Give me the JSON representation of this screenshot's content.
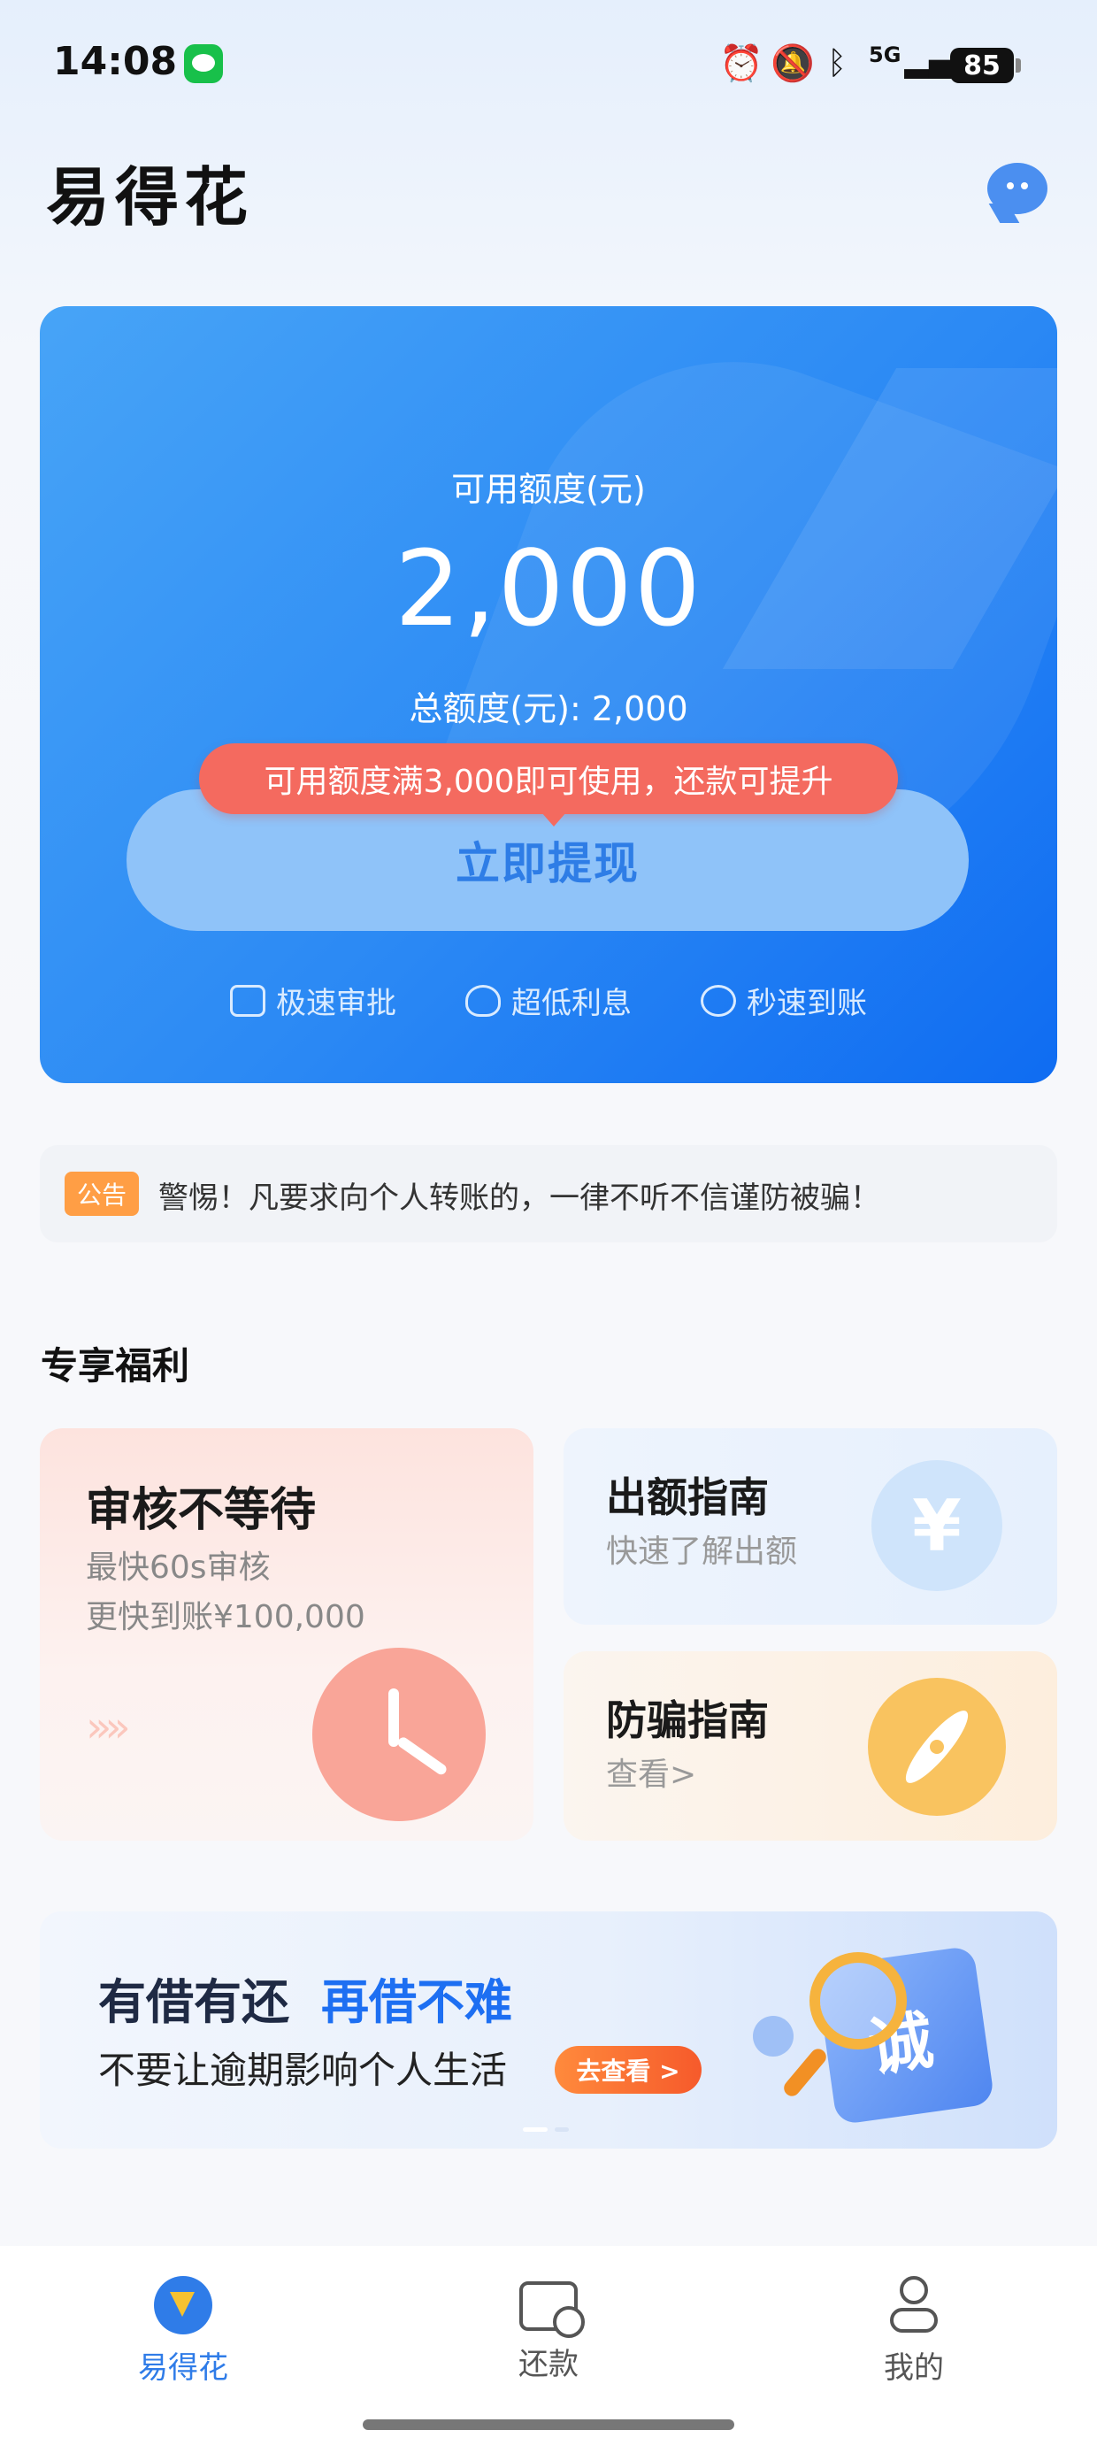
{
  "status_bar": {
    "time": "14:08",
    "network": "5G",
    "battery": "85",
    "icons": [
      "wechat-icon",
      "alarm-icon",
      "mute-icon",
      "bluetooth-icon",
      "signal-icon",
      "battery-icon"
    ]
  },
  "header": {
    "app_title": "易得花",
    "icons": [
      "chat-bubble-icon"
    ]
  },
  "credit_card": {
    "available_label": "可用额度(元)",
    "available_value": "2,000",
    "total_label": "总额度(元): 2,000",
    "tip": "可用额度满3,000即可使用，还款可提升",
    "withdraw_button": "立即提现",
    "features": [
      {
        "label": "极速审批",
        "icon": "fast-approval-icon"
      },
      {
        "label": "超低利息",
        "icon": "low-interest-icon"
      },
      {
        "label": "秒速到账",
        "icon": "instant-arrival-icon"
      }
    ]
  },
  "notice": {
    "badge": "公告",
    "text": "警惕！凡要求向个人转账的，一律不听不信谨防被骗！"
  },
  "benefits": {
    "section_title": "专享福利",
    "big": {
      "title": "审核不等待",
      "sub1": "最快60s审核",
      "sub2": "更快到账¥100,000",
      "arrows": "»»",
      "icon": "clock-icon"
    },
    "guide": {
      "title": "出额指南",
      "sub": "快速了解出额",
      "icon_glyph": "¥"
    },
    "fraud": {
      "title": "防骗指南",
      "sub": "查看>",
      "icon": "compass-icon"
    }
  },
  "banner": {
    "title_part1": "有借有还",
    "title_part2": "再借不难",
    "subtitle": "不要让逾期影响个人生活",
    "button": "去查看 >",
    "illustration_glyph": "诚",
    "page_count": 2,
    "active_page": 1
  },
  "tab_bar": {
    "tabs": [
      {
        "label": "易得花",
        "icon": "home-logo-icon",
        "active": true
      },
      {
        "label": "还款",
        "icon": "repayment-icon",
        "active": false
      },
      {
        "label": "我的",
        "icon": "profile-icon",
        "active": false
      }
    ]
  },
  "colors": {
    "accent": "#2f7ce8",
    "tip_red": "#f46a5f",
    "notice_orange": "#ff9e45",
    "banner_blue": "#1d6ff2"
  }
}
